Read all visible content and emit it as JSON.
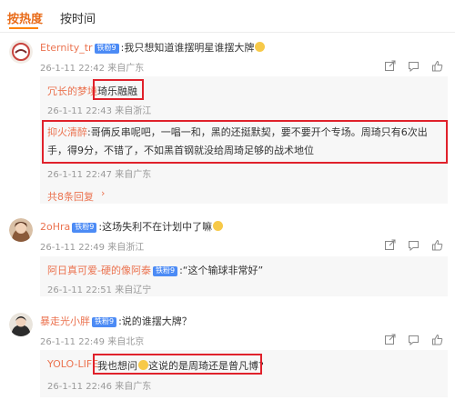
{
  "tabs": {
    "hot": "按热度",
    "time": "按时间"
  },
  "verified_badge": "铁粉9",
  "comments": [
    {
      "user": "Eternity_tr",
      "text": ":我只想知道谁摆明星谁摆大牌",
      "meta": "26-1-11 22:42 来自广东",
      "replies": [
        {
          "user": "冗长的梦境",
          "text": "琦乐融融",
          "meta": "26-1-11 22:43 来自浙江"
        },
        {
          "user": "抑火清醉",
          "text": ":哥俩反串呢吧，一唱一和，黑的还挺默契，要不要开个专场。周琦只有6次出手，得9分，不错了，不如黑首钢就没给周琦足够的战术地位",
          "meta": "26-1-11 22:47 来自广东"
        }
      ],
      "more": "共8条回复"
    },
    {
      "user": "2oHra",
      "text": ":这场失利不在计划中了嘛",
      "meta": "26-1-11 22:49 来自浙江",
      "replies": [
        {
          "user": "阿日真可爱-硬的像阿泰",
          "text": ":“这个输球非常好”",
          "meta": "26-1-11 22:51 来自辽宁"
        }
      ]
    },
    {
      "user": "暴走光小胖",
      "text": ":说的谁摆大牌？",
      "meta": "26-1-11 22:49 来自北京",
      "replies": [
        {
          "user": "YOLO-LIFE",
          "text": "我也想问",
          "text2": "这说的是周琦还是曾凡博?",
          "meta": "26-1-11 22:46 来自广东"
        }
      ]
    }
  ],
  "colors": {
    "accent": "#ff8200",
    "username": "#eb7350",
    "highlight_box": "#e0212b",
    "badge": "#4c8bf5"
  }
}
